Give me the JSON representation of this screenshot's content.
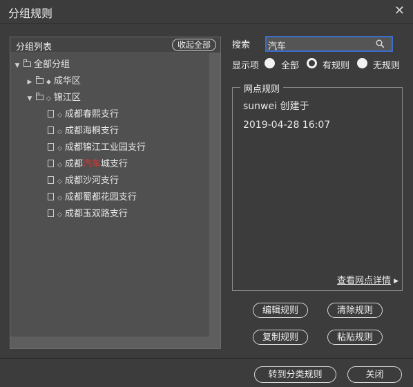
{
  "window": {
    "title": "分组规则"
  },
  "left_panel": {
    "title": "分组列表",
    "collapse_label": "收起全部",
    "tree": {
      "root": "全部分组",
      "districts": [
        {
          "label": "成华区"
        },
        {
          "label": "锦江区",
          "branches": [
            "成都春熙支行",
            "成都海桐支行",
            "成都锦江工业园支行",
            {
              "prefix": "成都",
              "highlight": "汽车",
              "suffix": "城支行"
            },
            "成都沙河支行",
            "成都蜀都花园支行",
            "成都玉双路支行"
          ]
        }
      ]
    }
  },
  "search": {
    "label": "搜索",
    "value": "汽车"
  },
  "display_filter": {
    "label": "显示项",
    "options": [
      "全部",
      "有规则",
      "无规则"
    ],
    "selected": "有规则"
  },
  "node_rules": {
    "legend": "网点规则",
    "creator_line": "sunwei 创建于",
    "created_at": "2019-04-28 16:07",
    "detail_link": "查看网点详情"
  },
  "actions": {
    "edit": "编辑规则",
    "clear": "清除规则",
    "copy": "复制规则",
    "paste": "粘贴规则"
  },
  "footer": {
    "goto_classify": "转到分类规则",
    "close": "关闭"
  }
}
